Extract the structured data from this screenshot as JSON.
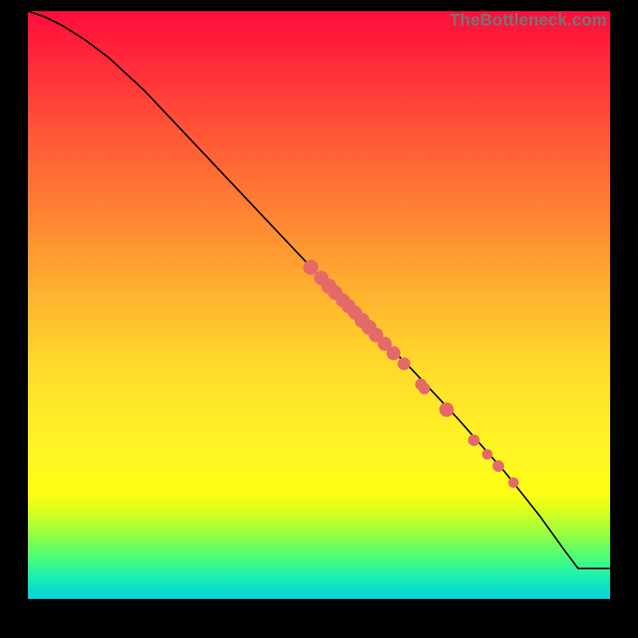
{
  "watermark": "TheBottleneck.com",
  "colors": {
    "point_fill": "#e46a6a"
  },
  "chart_data": {
    "type": "line",
    "title": "",
    "xlabel": "",
    "ylabel": "",
    "xlim": [
      0,
      100
    ],
    "ylim": [
      0,
      100
    ],
    "grid": false,
    "legend": false,
    "note": "No axis tick labels are rendered in the image; x and y are normalized 0–100 across the gradient plot area. Curve values estimated from pixel positions.",
    "series": [
      {
        "name": "curve",
        "x": [
          0,
          3,
          6,
          10,
          14,
          20,
          30,
          40,
          50,
          58,
          66,
          74,
          82,
          88,
          92,
          94.5,
          100
        ],
        "y": [
          100,
          99,
          97.5,
          95,
          92,
          86.5,
          76,
          65.5,
          55,
          47,
          39,
          30.5,
          21.5,
          14,
          8.5,
          5.2,
          5.2
        ]
      }
    ],
    "points": {
      "name": "highlight-points",
      "note": "Salmon circular markers overlaid on the curve; radius in plot-percent units.",
      "items": [
        {
          "x": 48.6,
          "y": 56.4,
          "r": 1.3
        },
        {
          "x": 50.4,
          "y": 54.6,
          "r": 1.25
        },
        {
          "x": 51.7,
          "y": 53.2,
          "r": 1.3
        },
        {
          "x": 52.8,
          "y": 52.1,
          "r": 1.25
        },
        {
          "x": 54.1,
          "y": 50.8,
          "r": 1.2
        },
        {
          "x": 55.1,
          "y": 49.8,
          "r": 1.2
        },
        {
          "x": 56.2,
          "y": 48.7,
          "r": 1.2
        },
        {
          "x": 57.4,
          "y": 47.4,
          "r": 1.3
        },
        {
          "x": 58.6,
          "y": 46.2,
          "r": 1.3
        },
        {
          "x": 59.8,
          "y": 44.9,
          "r": 1.25
        },
        {
          "x": 61.3,
          "y": 43.4,
          "r": 1.2
        },
        {
          "x": 62.8,
          "y": 41.8,
          "r": 1.2
        },
        {
          "x": 64.6,
          "y": 40.0,
          "r": 1.1
        },
        {
          "x": 67.5,
          "y": 36.5,
          "r": 1.0
        },
        {
          "x": 68.1,
          "y": 35.8,
          "r": 1.0
        },
        {
          "x": 71.9,
          "y": 32.2,
          "r": 1.25
        },
        {
          "x": 76.6,
          "y": 27.0,
          "r": 1.0
        },
        {
          "x": 78.9,
          "y": 24.6,
          "r": 0.9
        },
        {
          "x": 80.8,
          "y": 22.6,
          "r": 1.0
        },
        {
          "x": 83.4,
          "y": 19.8,
          "r": 0.9
        }
      ]
    }
  }
}
